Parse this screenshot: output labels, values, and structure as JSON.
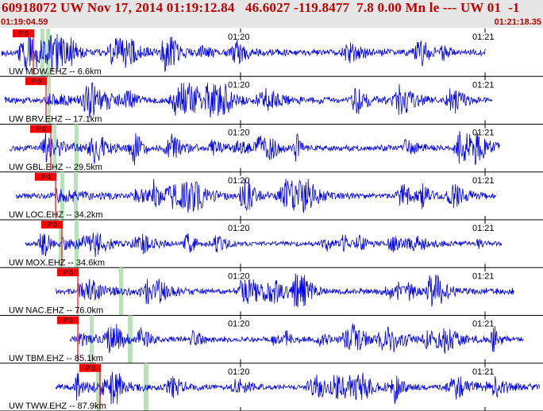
{
  "header": {
    "title": "60918072 UW Nov 17, 2014 01:19:12.84   46.6027 -119.8477  7.8 0.00 Mn le --- UW 01  -1",
    "start_time": "01:19:04.59",
    "end_time": "01:21:18.35"
  },
  "colors": {
    "header_bg": "#e6e6e6",
    "header_text": "#c00000",
    "trace": "#0000ee",
    "pick": "#ff0000",
    "arrival_band": "#b8e2b8",
    "grid": "#000000"
  },
  "minute_labels": [
    "01:20",
    "01:21"
  ],
  "traces": [
    {
      "label": "UW MDW.EHZ -- 6.6km",
      "pick": "P 0",
      "amplitude": 1.0
    },
    {
      "label": "UW BRV.EHZ -- 17.1km",
      "pick": "P 0",
      "amplitude": 0.95
    },
    {
      "label": "UW GBL.EHZ -- 29.5km",
      "pick": "P 0",
      "amplitude": 0.9
    },
    {
      "label": "UW LOC.EHZ -- 34.2km",
      "pick": "P 0",
      "amplitude": 0.9
    },
    {
      "label": "UW MOX.EHZ -- 34.6km",
      "pick": "P 0",
      "amplitude": 0.7
    },
    {
      "label": "UW NAC.EHZ -- 76.0km",
      "pick": "P 0",
      "amplitude": 0.95
    },
    {
      "label": "UW TBM.EHZ -- 85.1km",
      "pick": "P 0",
      "amplitude": 0.85
    },
    {
      "label": "UW TWW.EHZ -- 87.9km",
      "pick": "P 0",
      "amplitude": 0.9
    }
  ]
}
